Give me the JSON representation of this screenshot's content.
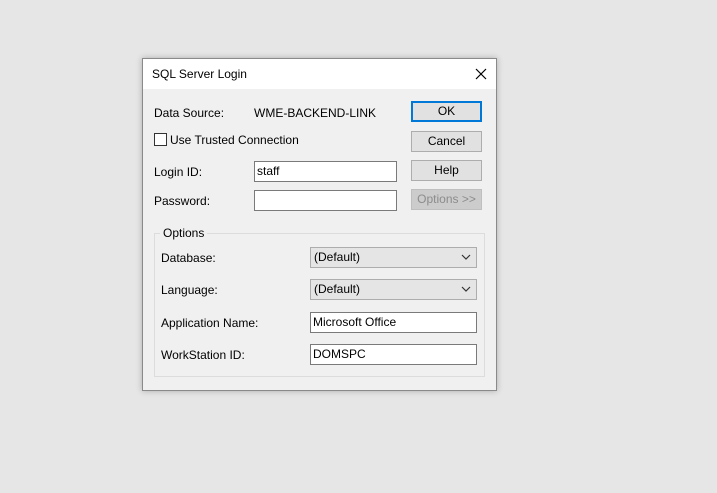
{
  "dialog": {
    "title": "SQL Server Login",
    "close_icon": "close-icon"
  },
  "data_source": {
    "label": "Data Source:",
    "value": "WME-BACKEND-LINK"
  },
  "trusted": {
    "label": "Use Trusted Connection",
    "checked": false
  },
  "login": {
    "label": "Login ID:",
    "value": "staff"
  },
  "password": {
    "label": "Password:",
    "value": ""
  },
  "buttons": {
    "ok": "OK",
    "cancel": "Cancel",
    "help": "Help",
    "options": "Options >>"
  },
  "options": {
    "group_label": "Options",
    "database": {
      "label": "Database:",
      "value": "(Default)"
    },
    "language": {
      "label": "Language:",
      "value": "(Default)"
    },
    "app_name": {
      "label": "Application Name:",
      "value": "Microsoft Office"
    },
    "workstation": {
      "label": "WorkStation ID:",
      "value": "DOMSPC"
    }
  }
}
